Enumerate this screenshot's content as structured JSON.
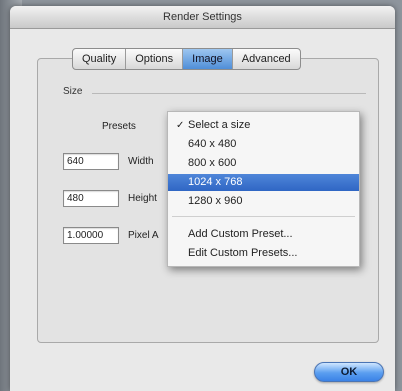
{
  "window": {
    "title": "Render Settings"
  },
  "tabs": [
    {
      "label": "Quality"
    },
    {
      "label": "Options"
    },
    {
      "label": "Image",
      "active": true
    },
    {
      "label": "Advanced"
    }
  ],
  "size_group": {
    "label": "Size"
  },
  "presets": {
    "label": "Presets"
  },
  "fields": {
    "width": {
      "value": "640",
      "label": "Width"
    },
    "height": {
      "value": "480",
      "label": "Height"
    },
    "pixel_aspect": {
      "value": "1.00000",
      "label": "Pixel A"
    }
  },
  "menu": {
    "items": [
      {
        "label": "Select a size",
        "checked": true
      },
      {
        "label": "640 x 480"
      },
      {
        "label": "800 x 600"
      },
      {
        "label": "1024 x 768",
        "highlighted": true
      },
      {
        "label": "1280 x 960"
      },
      {
        "label": "Add Custom Preset..."
      },
      {
        "label": "Edit Custom Presets..."
      }
    ],
    "check_glyph": "✓"
  },
  "buttons": {
    "ok": "OK"
  }
}
